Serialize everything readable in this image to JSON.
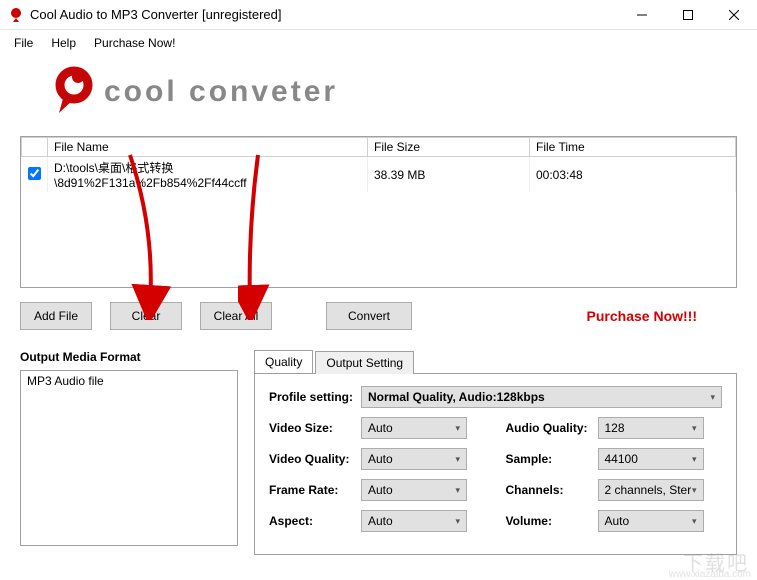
{
  "window": {
    "title": "Cool Audio to MP3 Converter  [unregistered]"
  },
  "menu": {
    "file": "File",
    "help": "Help",
    "purchase": "Purchase Now!"
  },
  "logo_text": "cool conveter",
  "table": {
    "headers": {
      "name": "File Name",
      "size": "File Size",
      "time": "File Time"
    },
    "rows": [
      {
        "checked": true,
        "name": "D:\\tools\\桌面\\格式转换\\8d91%2F131a%2Fb854%2Ff44ccff",
        "size": "38.39 MB",
        "time": "00:03:48"
      }
    ]
  },
  "buttons": {
    "add": "Add File",
    "clear": "Clear",
    "clear_all": "Clear All",
    "convert": "Convert",
    "purchase_now": "Purchase Now!!!"
  },
  "format_panel": {
    "title": "Output Media Format",
    "item": "MP3 Audio file"
  },
  "tabs": {
    "quality": "Quality",
    "output": "Output Setting"
  },
  "settings": {
    "profile_label": "Profile setting:",
    "profile_value": "Normal Quality, Audio:128kbps",
    "video_size_label": "Video Size:",
    "video_size_value": "Auto",
    "audio_quality_label": "Audio Quality:",
    "audio_quality_value": "128",
    "video_quality_label": "Video Quality:",
    "video_quality_value": "Auto",
    "sample_label": "Sample:",
    "sample_value": "44100",
    "frame_rate_label": "Frame Rate:",
    "frame_rate_value": "Auto",
    "channels_label": "Channels:",
    "channels_value": "2 channels, Ster",
    "aspect_label": "Aspect:",
    "aspect_value": "Auto",
    "volume_label": "Volume:",
    "volume_value": "Auto"
  },
  "watermark": "下载吧",
  "watermark_url": "www.xiazaiba.com"
}
